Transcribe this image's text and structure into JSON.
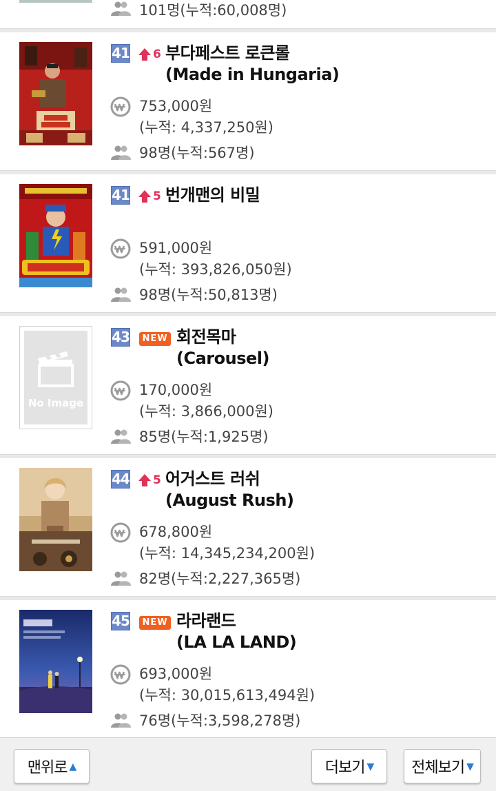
{
  "colors": {
    "rank_badge": "#6b88c8",
    "rank_up": "#e0325a",
    "new_badge": "#f06020",
    "divider": "#e9e9e9",
    "caret": "#2a7ad8"
  },
  "partial_row": {
    "people": "101명(누적:60,008명)"
  },
  "movies": [
    {
      "rank": "41",
      "change_type": "up",
      "change": "6",
      "title_line1": "부다페스트 로큰롤",
      "title_line2": "(Made in Hungaria)",
      "amount": "753,000원",
      "amount_cum": "(누적: 4,337,250원)",
      "people": "98명(누적:567명)",
      "poster": "budapest-rocknroll-poster"
    },
    {
      "rank": "41",
      "change_type": "up",
      "change": "5",
      "title_line1": "번개맨의 비밀",
      "title_line2": "",
      "amount": "591,000원",
      "amount_cum": "(누적: 393,826,050원)",
      "people": "98명(누적:50,813명)",
      "poster": "lightning-man-poster"
    },
    {
      "rank": "43",
      "change_type": "new",
      "new_label": "NEW",
      "title_line1": "회전목마",
      "title_line2": "(Carousel)",
      "amount": "170,000원",
      "amount_cum": "(누적: 3,866,000원)",
      "people": "85명(누적:1,925명)",
      "poster": "no-image",
      "no_image_label": "No Image"
    },
    {
      "rank": "44",
      "change_type": "up",
      "change": "5",
      "title_line1": "어거스트 러쉬",
      "title_line2": "(August Rush)",
      "amount": "678,800원",
      "amount_cum": "(누적: 14,345,234,200원)",
      "people": "82명(누적:2,227,365명)",
      "poster": "august-rush-poster"
    },
    {
      "rank": "45",
      "change_type": "new",
      "new_label": "NEW",
      "title_line1": "라라랜드",
      "title_line2": "(LA LA LAND)",
      "amount": "693,000원",
      "amount_cum": "(누적: 30,015,613,494원)",
      "people": "76명(누적:3,598,278명)",
      "poster": "la-la-land-poster"
    }
  ],
  "footer": {
    "top_label": "맨위로",
    "more_label": "더보기",
    "all_label": "전체보기"
  }
}
